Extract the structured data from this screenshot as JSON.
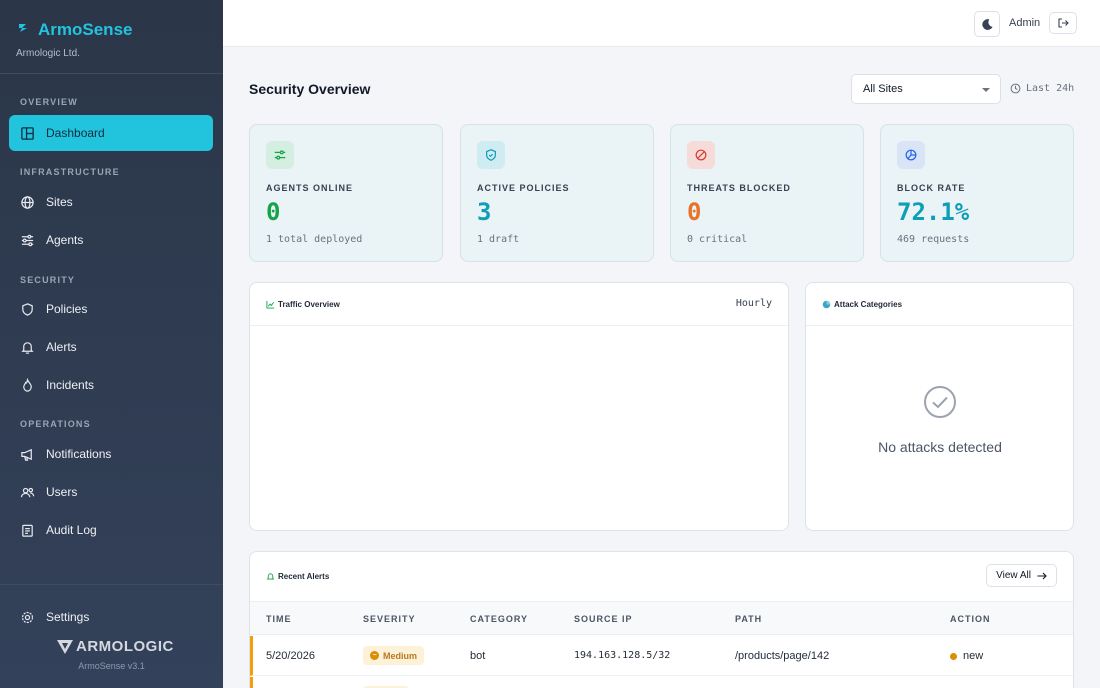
{
  "brand": {
    "name": "ArmoSense",
    "org": "Armologic Ltd.",
    "logo_text": "ARMOLOGIC",
    "version": "ArmoSense v3.1"
  },
  "sidebar": {
    "sections": {
      "overview": "OVERVIEW",
      "infrastructure": "INFRASTRUCTURE",
      "security": "SECURITY",
      "operations": "OPERATIONS"
    },
    "items": {
      "dashboard": "Dashboard",
      "sites": "Sites",
      "agents": "Agents",
      "policies": "Policies",
      "alerts": "Alerts",
      "incidents": "Incidents",
      "notifications": "Notifications",
      "users": "Users",
      "audit_log": "Audit Log",
      "settings": "Settings"
    }
  },
  "topbar": {
    "user": "Admin"
  },
  "main": {
    "title": "Security Overview",
    "site_select": "All Sites",
    "range": "Last 24h"
  },
  "stats": [
    {
      "label": "AGENTS ONLINE",
      "value": "0",
      "sub": "1 total deployed",
      "color": "#16a34a"
    },
    {
      "label": "ACTIVE POLICIES",
      "value": "3",
      "sub": "1 draft",
      "color": "#0e9fb8"
    },
    {
      "label": "THREATS BLOCKED",
      "value": "0",
      "sub": "0 critical",
      "color": "#e8742a"
    },
    {
      "label": "BLOCK RATE",
      "value": "72.1%",
      "sub": "469 requests",
      "color": "#0e9fb8"
    }
  ],
  "traffic": {
    "title": "Traffic Overview",
    "interval": "Hourly"
  },
  "attacks": {
    "title": "Attack Categories",
    "empty": "No attacks detected"
  },
  "recent_alerts": {
    "title": "Recent Alerts",
    "view_all": "View All",
    "columns": [
      "TIME",
      "SEVERITY",
      "CATEGORY",
      "SOURCE IP",
      "PATH",
      "ACTION"
    ],
    "rows": [
      {
        "time": "5/20/2026",
        "severity": "Medium",
        "category": "bot",
        "source_ip": "194.163.128.5/32",
        "path": "/products/page/142",
        "action": "new"
      }
    ]
  }
}
